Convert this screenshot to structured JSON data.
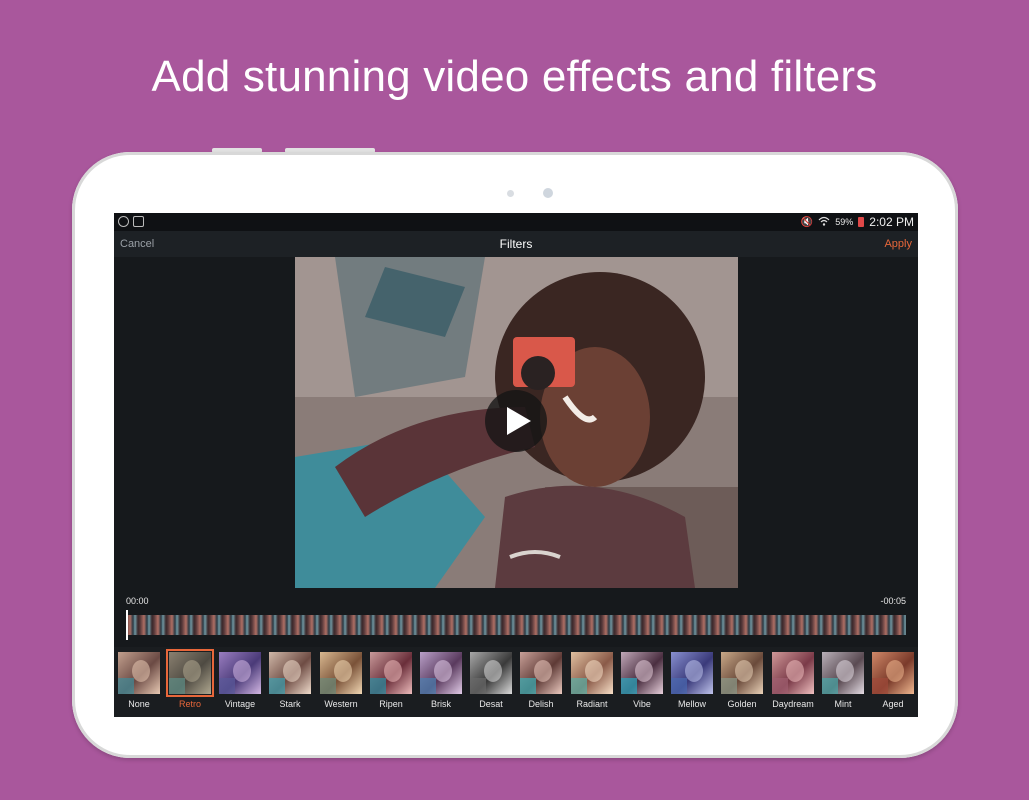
{
  "headline": "Add stunning video effects and filters",
  "colors": {
    "background": "#a9579c",
    "accent": "#e8673a"
  },
  "status_bar": {
    "battery": "59%",
    "time": "2:02 PM",
    "icons": [
      "do-not-disturb-icon",
      "notification-icon",
      "mute-icon",
      "wifi-icon",
      "battery-icon"
    ]
  },
  "title_bar": {
    "cancel_label": "Cancel",
    "title": "Filters",
    "apply_label": "Apply"
  },
  "player": {
    "current_time": "00:00",
    "remaining_time": "-00:05",
    "play_icon": "play-icon"
  },
  "filters": {
    "selected": "Retro",
    "items": [
      {
        "label": "None"
      },
      {
        "label": "Retro"
      },
      {
        "label": "Vintage"
      },
      {
        "label": "Stark"
      },
      {
        "label": "Western"
      },
      {
        "label": "Ripen"
      },
      {
        "label": "Brisk"
      },
      {
        "label": "Desat"
      },
      {
        "label": "Delish"
      },
      {
        "label": "Radiant"
      },
      {
        "label": "Vibe"
      },
      {
        "label": "Mellow"
      },
      {
        "label": "Golden"
      },
      {
        "label": "Daydream"
      },
      {
        "label": "Mint"
      },
      {
        "label": "Aged"
      }
    ]
  }
}
